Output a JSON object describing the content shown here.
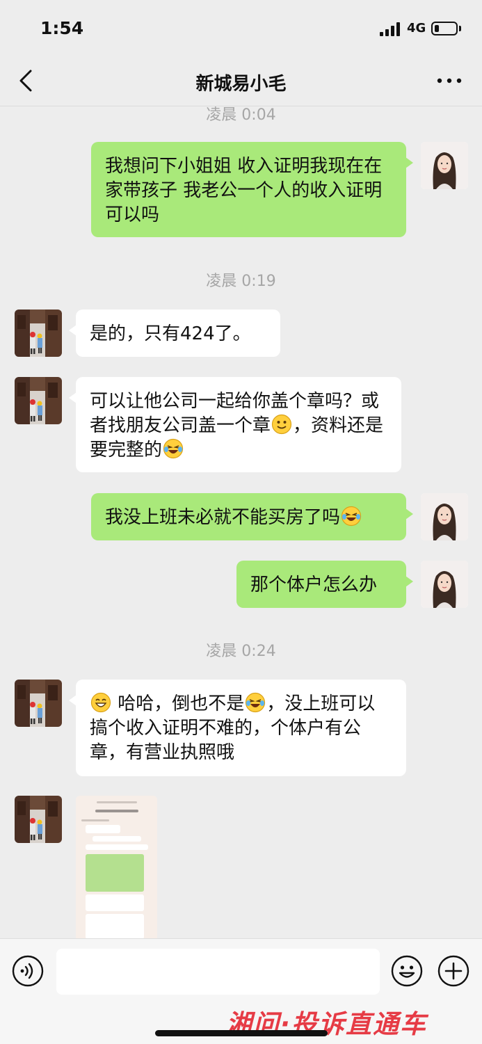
{
  "status_bar": {
    "time": "1:54",
    "network": "4G"
  },
  "nav": {
    "title": "新城易小毛"
  },
  "chat": {
    "timestamps": [
      "凌晨 0:04",
      "凌晨 0:19",
      "凌晨 0:24"
    ],
    "messages": [
      {
        "side": "right",
        "text": "我想问下小姐姐 收入证明我现在在家带孩子 我老公一个人的收入证明可以吗"
      },
      {
        "side": "left",
        "text": "是的，只有424了。"
      },
      {
        "side": "left",
        "parts": [
          "可以让他公司一起给你盖个章吗？或者找朋友公司盖一个章",
          "，资料还是要完整的"
        ],
        "emojis": [
          "smile-emoji",
          "laugh-cry-emoji"
        ]
      },
      {
        "side": "right",
        "parts": [
          "我没上班未必就不能买房了吗"
        ],
        "emojis": [
          "laugh-cry-emoji"
        ]
      },
      {
        "side": "right",
        "text": "那个体户怎么办"
      },
      {
        "side": "left",
        "parts": [
          "哈哈，倒也不是",
          "，没上班可以搞个收入证明不难的，个体户有公章，有营业执照哦"
        ],
        "emojis": [
          "grin-emoji",
          "laugh-cry-emoji"
        ]
      },
      {
        "side": "left",
        "type": "image",
        "description": "screenshot"
      }
    ]
  },
  "input_bar": {
    "placeholder": ""
  },
  "watermark": {
    "text": "湘问·投诉直通车"
  },
  "colors": {
    "sent_bubble": "#a9e97a",
    "received_bubble": "#ffffff",
    "background": "#ededed",
    "watermark": "#e63b45"
  }
}
